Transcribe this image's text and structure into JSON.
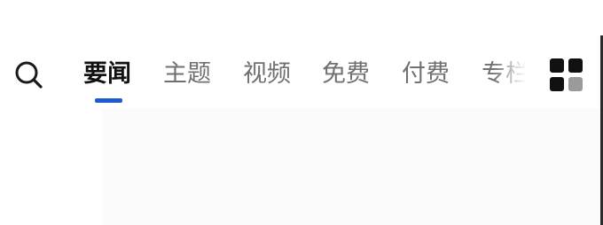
{
  "header": {
    "search_icon": "search-icon",
    "tabs": [
      {
        "label": "要闻",
        "active": true
      },
      {
        "label": "主题",
        "active": false
      },
      {
        "label": "视频",
        "active": false
      },
      {
        "label": "免费",
        "active": false
      },
      {
        "label": "付费",
        "active": false
      },
      {
        "label": "专栏",
        "active": false
      }
    ],
    "grid_icon": "grid-menu-icon"
  },
  "colors": {
    "accent": "#1f5bd0",
    "active_text": "#111111",
    "inactive_text": "#707070"
  }
}
